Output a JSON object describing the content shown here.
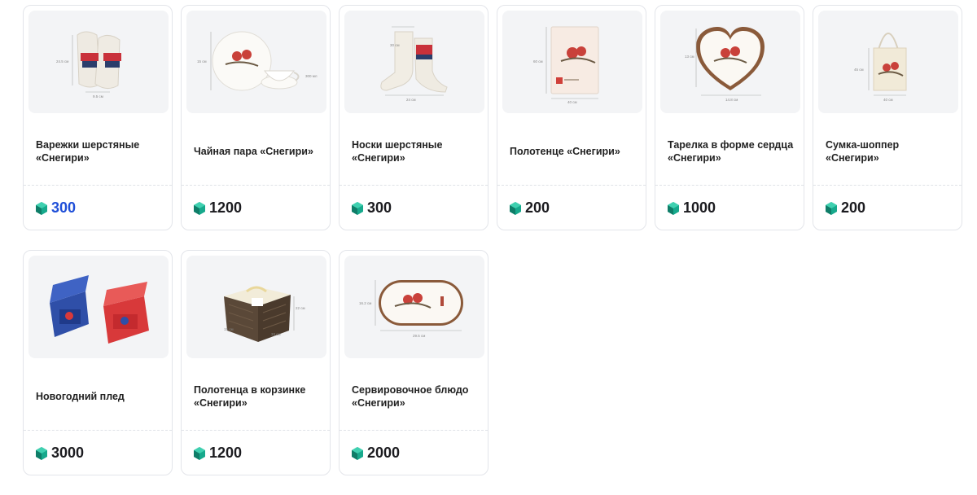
{
  "colors": {
    "accent": "#1f4fd8",
    "coin": "#17a98c",
    "text": "#1b1b1f"
  },
  "products": [
    {
      "title": "Варежки шерстяные «Снегири»",
      "price": "300",
      "dims": [
        "24.5 см",
        "9.5 см"
      ]
    },
    {
      "title": "Чайная пара «Снегири»",
      "price": "1200",
      "dims": [
        "15 см",
        "300 мл"
      ]
    },
    {
      "title": "Носки шерстяные «Снегири»",
      "price": "300",
      "dims": [
        "30 см",
        "24 см"
      ]
    },
    {
      "title": "Полотенце «Снегири»",
      "price": "200",
      "dims": [
        "60 см",
        "40 см"
      ]
    },
    {
      "title": "Тарелка в форме сердца «Снегири»",
      "price": "1000",
      "dims": [
        "13 см",
        "14.8 см"
      ]
    },
    {
      "title": "Сумка-шоппер «Снегири»",
      "price": "200",
      "dims": [
        "45 см",
        "40 см"
      ]
    },
    {
      "title": "Новогодний плед",
      "price": "3000",
      "dims": []
    },
    {
      "title": "Полотенца в корзинке «Снегири»",
      "price": "1200",
      "dims": [
        "22 см",
        "15 см",
        "33 см"
      ]
    },
    {
      "title": "Сервировочное блюдо «Снегири»",
      "price": "2000",
      "dims": [
        "16.2 см",
        "29.5 см"
      ]
    }
  ]
}
